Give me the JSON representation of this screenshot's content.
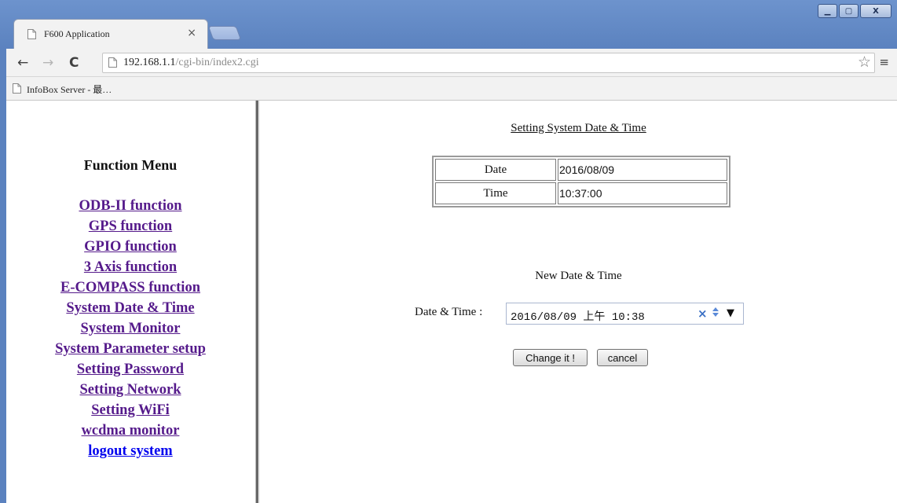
{
  "browser": {
    "tab_title": "F600 Application",
    "tab_close": "×",
    "url_host": "192.168.1.1",
    "url_path": "/cgi-bin/index2.cgi",
    "bookmark_label": "InfoBox Server - 最…",
    "nav": {
      "back": "←",
      "forward": "→",
      "reload": "C"
    },
    "star": "☆",
    "menu": "≡",
    "window_controls": {
      "minimize": "▁",
      "maximize": "▢",
      "close": "X"
    }
  },
  "sidebar": {
    "title": "Function Menu",
    "items": [
      {
        "label": "ODB-II function"
      },
      {
        "label": "GPS function"
      },
      {
        "label": "GPIO function"
      },
      {
        "label": "3 Axis function"
      },
      {
        "label": "E-COMPASS function"
      },
      {
        "label": "System Date & Time"
      },
      {
        "label": "System Monitor"
      },
      {
        "label": "System Parameter setup"
      },
      {
        "label": "Setting Password"
      },
      {
        "label": "Setting Network"
      },
      {
        "label": "Setting WiFi"
      },
      {
        "label": "wcdma monitor"
      },
      {
        "label": "logout system"
      }
    ],
    "visited_color": "#551a8b",
    "link_color": "#0000ee"
  },
  "main": {
    "heading": "Setting System Date & Time",
    "table": [
      {
        "label": "Date",
        "value": "2016/08/09"
      },
      {
        "label": "Time",
        "value": "10:37:00"
      }
    ],
    "new_title": "New Date & Time",
    "datetime_label": "Date & Time :",
    "datetime_value": "2016/08/09 上午 10:38",
    "clear_glyph": "×",
    "dropdown_glyph": "▼",
    "change_button": "Change it !",
    "cancel_button": "cancel"
  }
}
